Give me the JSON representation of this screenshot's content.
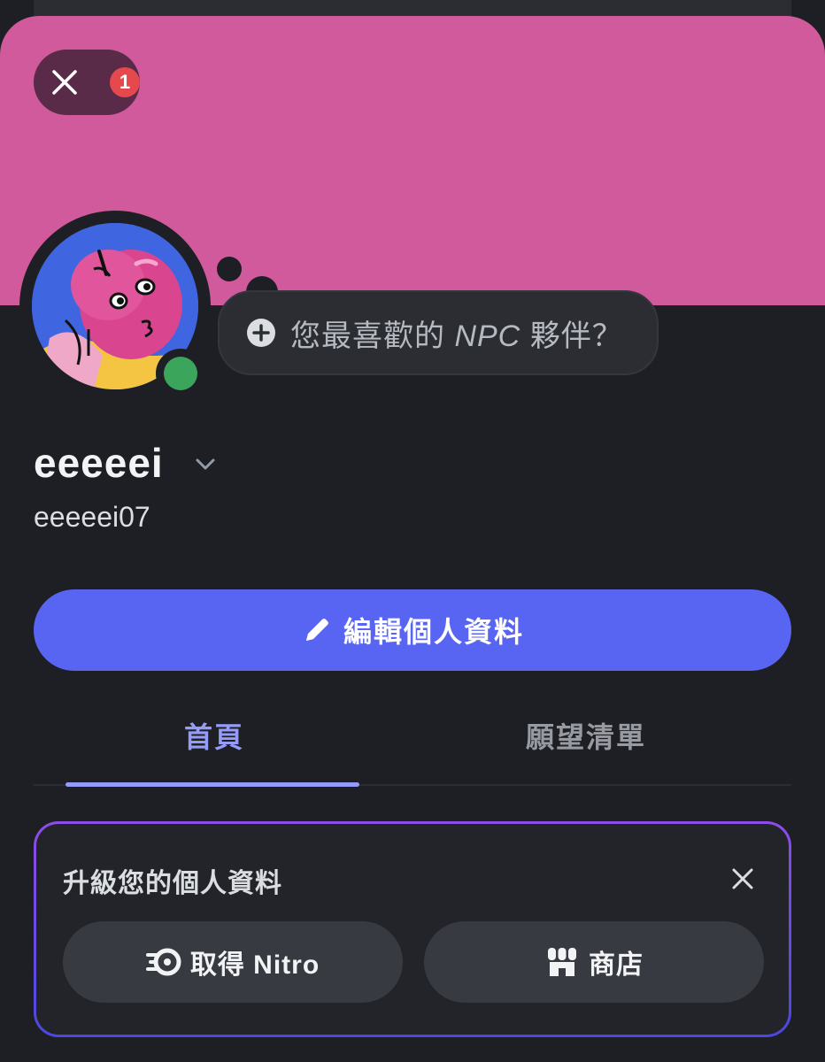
{
  "header": {
    "notification_count": "1"
  },
  "status_bubble": {
    "prompt_before": "您最喜歡的 ",
    "prompt_italic": "NPC",
    "prompt_after": " 夥伴？"
  },
  "profile": {
    "display_name": "eeeeei",
    "username": "eeeeei07",
    "status": "online",
    "status_color": "#3ba55c",
    "banner_color": "#d05a9c"
  },
  "actions": {
    "edit_profile_label": "編輯個人資料",
    "accent_color": "#5865f2"
  },
  "tabs": [
    {
      "label": "首頁",
      "active": true
    },
    {
      "label": "願望清單",
      "active": false
    }
  ],
  "upgrade_card": {
    "title": "升級您的個人資料",
    "nitro_label": "取得 Nitro",
    "shop_label": "商店"
  }
}
